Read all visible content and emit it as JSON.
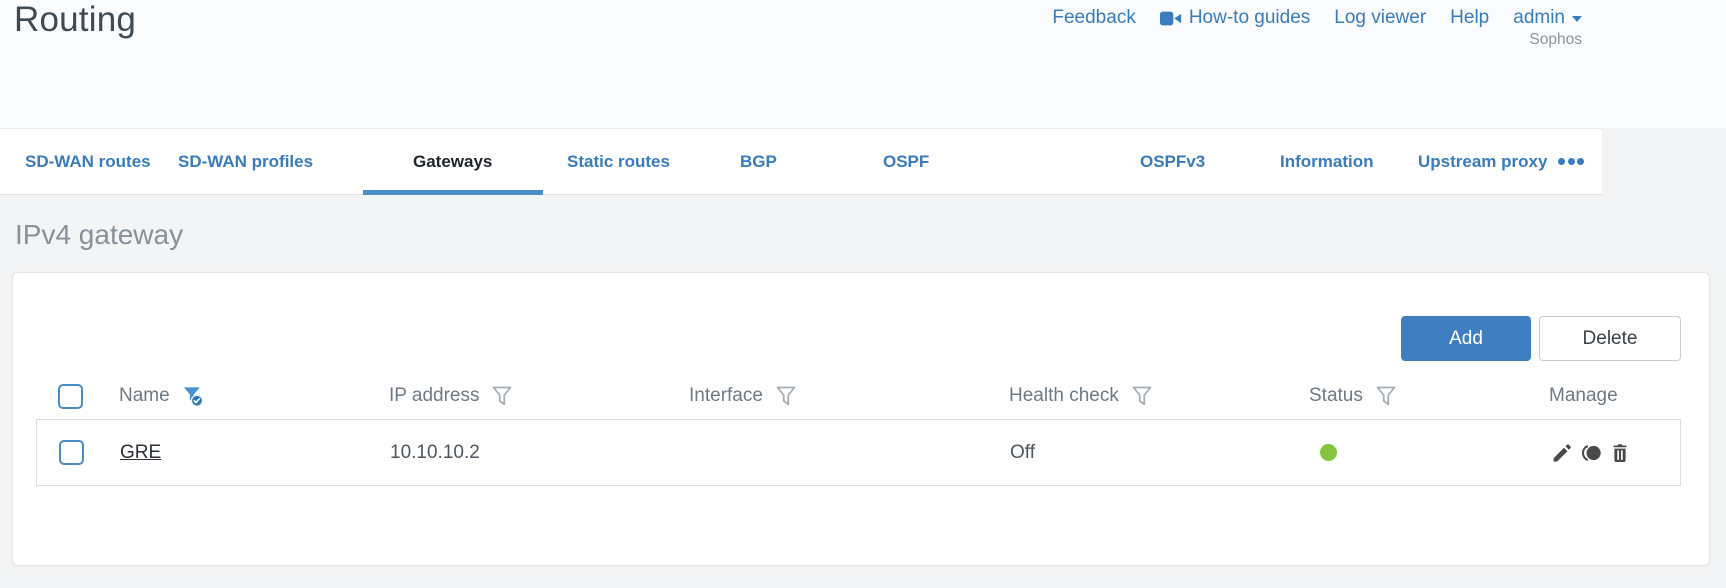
{
  "header": {
    "title": "Routing",
    "links": {
      "feedback": "Feedback",
      "howto": "How-to guides",
      "log_viewer": "Log viewer",
      "help": "Help",
      "user": "admin"
    },
    "brand": "Sophos"
  },
  "tabs": [
    {
      "label": "SD-WAN routes",
      "active": false
    },
    {
      "label": "SD-WAN profiles",
      "active": false
    },
    {
      "label": "Gateways",
      "active": true
    },
    {
      "label": "Static routes",
      "active": false
    },
    {
      "label": "BGP",
      "active": false
    },
    {
      "label": "OSPF",
      "active": false
    },
    {
      "label": "OSPFv3",
      "active": false
    },
    {
      "label": "Information",
      "active": false
    },
    {
      "label": "Upstream proxy",
      "active": false
    }
  ],
  "section_title": "IPv4 gateway",
  "toolbar": {
    "add": "Add",
    "delete": "Delete"
  },
  "table": {
    "columns": [
      "Name",
      "IP address",
      "Interface",
      "Health check",
      "Status",
      "Manage"
    ],
    "filtered_column": "Name",
    "rows": [
      {
        "name": "GRE",
        "ip": "10.10.10.2",
        "interface": "",
        "health_check": "Off",
        "status": "up"
      }
    ]
  },
  "icons": {
    "howto": "video-camera",
    "admin": "chevron-down",
    "column_filter": "funnel",
    "name_filter": "funnel-with-check",
    "more_tabs": "ellipsis",
    "manage": [
      "pencil",
      "clone",
      "trash"
    ],
    "status_up": "green-dot"
  },
  "colors": {
    "accent_blue": "#3a7cbd",
    "active_tab_underline": "#4a8ecb",
    "add_button_bg": "#3e7ec1",
    "status_green": "#84c441",
    "title_gray": "#87919a",
    "content_bg": "#f3f4f5"
  }
}
